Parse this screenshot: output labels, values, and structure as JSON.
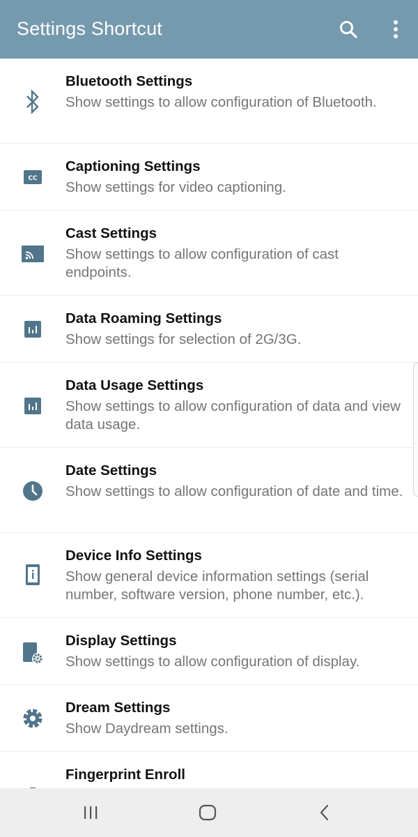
{
  "app": {
    "title": "Settings Shortcut",
    "accent_color": "#7599ad",
    "icons": [
      "search-icon",
      "more-vert-icon"
    ]
  },
  "items": [
    {
      "name": "Bluetooth Settings",
      "description": "Show settings to allow configuration of Bluetooth.",
      "icon": "bluetooth-icon"
    },
    {
      "name": "Captioning Settings",
      "description": "Show settings for video captioning.",
      "icon": "closed-caption-icon"
    },
    {
      "name": "Cast Settings",
      "description": "Show settings to allow configuration of cast endpoints.",
      "icon": "cast-icon"
    },
    {
      "name": "Data Roaming Settings",
      "description": "Show settings for selection of 2G/3G.",
      "icon": "data-usage-icon"
    },
    {
      "name": "Data Usage Settings",
      "description": "Show settings to allow configuration of data and view data usage.",
      "icon": "data-usage-icon"
    },
    {
      "name": "Date Settings",
      "description": "Show settings to allow configuration of date and time.",
      "icon": "clock-icon"
    },
    {
      "name": "Device Info Settings",
      "description": "Show general device information settings (serial number, software version, phone number, etc.).",
      "icon": "device-info-icon"
    },
    {
      "name": "Display Settings",
      "description": "Show settings to allow configuration of display.",
      "icon": "display-settings-icon"
    },
    {
      "name": "Dream Settings",
      "description": "Show Daydream settings.",
      "icon": "gear-icon"
    },
    {
      "name": "Fingerprint Enroll",
      "description": "",
      "icon": "fingerprint-icon"
    }
  ],
  "navbar": {
    "icons": [
      "recents-icon",
      "home-icon",
      "back-icon"
    ]
  }
}
